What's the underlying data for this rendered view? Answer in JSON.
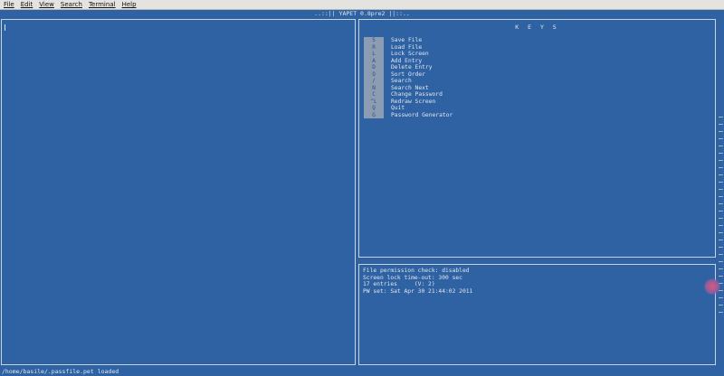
{
  "menubar": {
    "items": [
      "File",
      "Edit",
      "View",
      "Search",
      "Terminal",
      "Help"
    ]
  },
  "title": "..::|| YAPET 0.8pre2 ||::..",
  "keys_panel": {
    "title": "K E Y S",
    "items": [
      {
        "key": "S",
        "label": "Save File"
      },
      {
        "key": "R",
        "label": "Load File"
      },
      {
        "key": "L",
        "label": "Lock Screen"
      },
      {
        "key": "A",
        "label": "Add Entry"
      },
      {
        "key": "D",
        "label": "Delete Entry"
      },
      {
        "key": "O",
        "label": "Sort Order"
      },
      {
        "key": "/",
        "label": "Search"
      },
      {
        "key": "N",
        "label": "Search Next"
      },
      {
        "key": "C",
        "label": "Change Password"
      },
      {
        "key": "^L",
        "label": "Redraw Screen"
      },
      {
        "key": "Q",
        "label": "Quit"
      },
      {
        "key": "G",
        "label": "Password Generator"
      }
    ]
  },
  "info_panel": {
    "lines": [
      "File permission check: disabled",
      "Screen lock time-out: 300 sec",
      "17 entries     (V: 2)",
      "PW set: Sat Apr 30 21:44:02 2011"
    ]
  },
  "status": "/home/basile/.passfile.pet loaded"
}
